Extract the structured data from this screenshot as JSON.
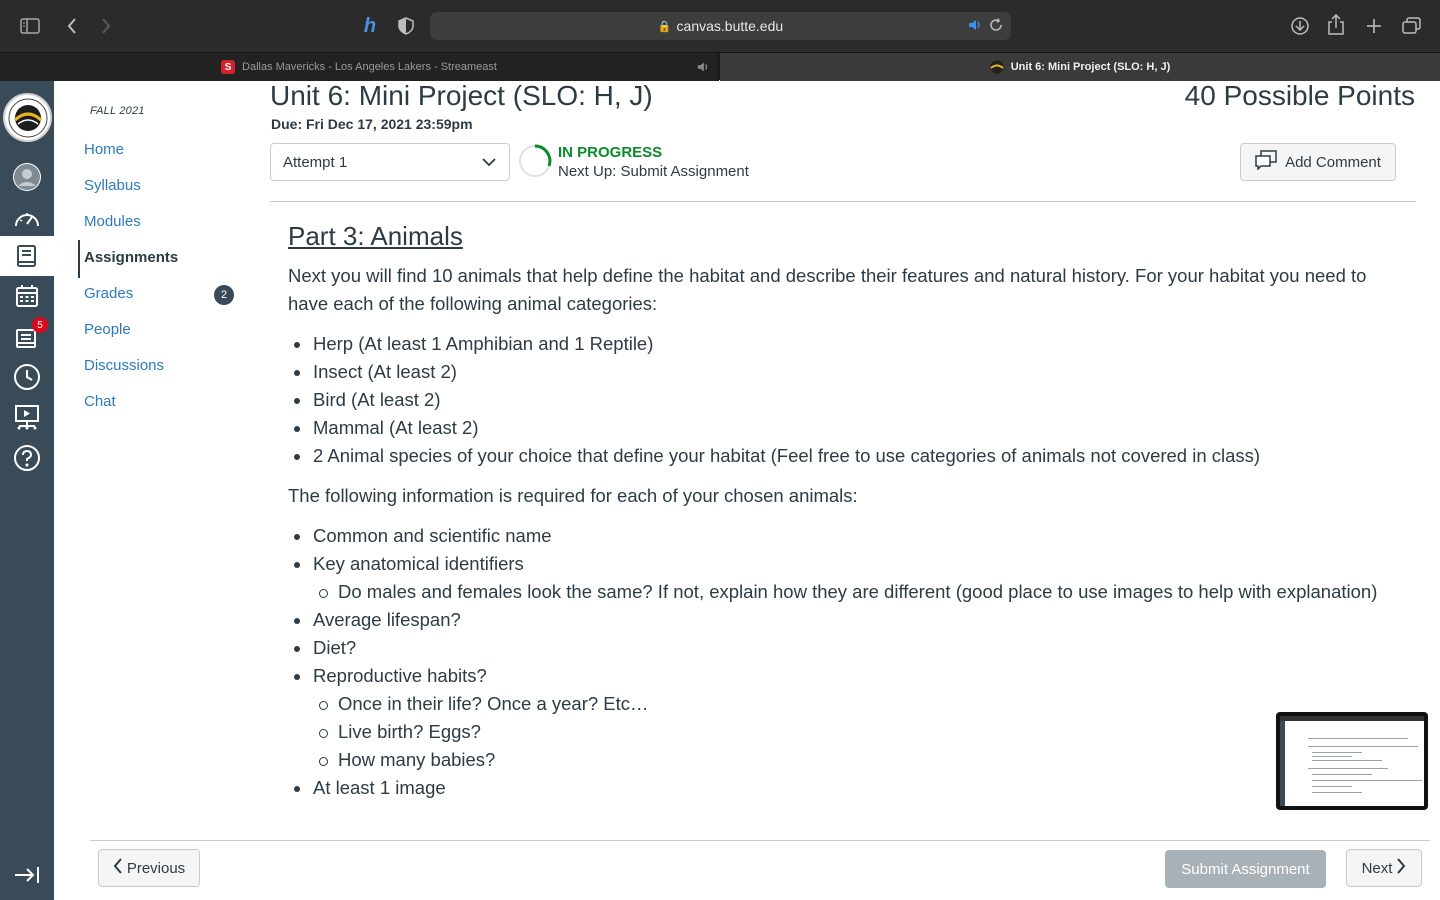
{
  "browser": {
    "url": "canvas.butte.edu",
    "tabs": [
      {
        "title": "Dallas Mavericks - Los Angeles Lakers - Streameast",
        "favicon": "S"
      },
      {
        "title": "Unit 6: Mini Project (SLO: H, J)"
      }
    ]
  },
  "global_nav": {
    "inbox_badge": "5"
  },
  "course_nav": {
    "term": "FALL 2021",
    "items": [
      {
        "label": "Home"
      },
      {
        "label": "Syllabus"
      },
      {
        "label": "Modules"
      },
      {
        "label": "Assignments"
      },
      {
        "label": "Grades"
      },
      {
        "label": "People"
      },
      {
        "label": "Discussions"
      },
      {
        "label": "Chat"
      }
    ],
    "grades_badge": "2"
  },
  "assignment": {
    "title": "Unit 6: Mini Project (SLO: H, J)",
    "due": "Due: Fri Dec 17, 2021 23:59pm",
    "points": "40 Possible Points",
    "attempt": "Attempt 1",
    "status": "IN PROGRESS",
    "next_up": "Next Up: Submit Assignment",
    "add_comment": "Add Comment"
  },
  "content": {
    "heading": "Part 3: Animals",
    "intro": "Next you will find 10 animals that help define the habitat and describe their features and natural history. For your habitat you need to have each of the following animal categories:",
    "categories": [
      "Herp (At least 1 Amphibian and 1 Reptile)",
      "Insect (At least 2)",
      "Bird (At least 2)",
      "Mammal (At least 2)",
      "2 Animal species of your choice that define your habitat (Feel free to use categories of animals not covered in class)"
    ],
    "info_intro": "The following information is required for each of your chosen animals:",
    "info_items": [
      "Common and scientific name",
      "Key anatomical identifiers",
      "Do males and females look the same? If not, explain how they are different (good place to use images to help with explanation)",
      "Average lifespan?",
      "Diet?",
      "Reproductive habits?",
      "Once in their life? Once a year? Etc…",
      "Live birth? Eggs?",
      "How many babies?",
      "At least 1 image"
    ]
  },
  "footer": {
    "previous": "Previous",
    "submit": "Submit Assignment",
    "next": "Next"
  }
}
